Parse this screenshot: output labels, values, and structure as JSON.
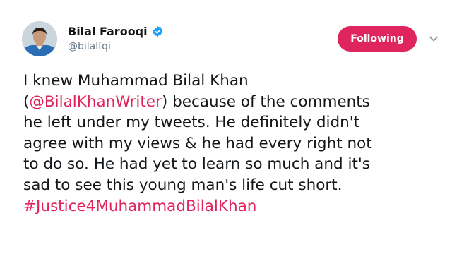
{
  "user": {
    "display_name": "Bilal Farooqi",
    "handle": "@bilalfqi",
    "verified": true
  },
  "actions": {
    "follow_label": "Following"
  },
  "colors": {
    "accent": "#e0245e",
    "verified_blue": "#1da1f2",
    "text": "#14171a",
    "muted": "#657786"
  },
  "icons": {
    "verified": "verified-badge-icon",
    "caret": "chevron-down-icon"
  },
  "tweet": {
    "line1": "I knew Muhammad Bilal Khan",
    "line2_open": "(",
    "line2_mention": "@BilalKhanWriter",
    "line2_rest": ") because of the comments",
    "line3": "he left under my tweets. He definitely didn't",
    "line4": "agree with my views & he had every right not",
    "line5": "to do so. He had yet to learn so much and it's",
    "line6": "sad to see this young man's life cut short.",
    "hashtag": "#Justice4MuhammadBilalKhan"
  }
}
